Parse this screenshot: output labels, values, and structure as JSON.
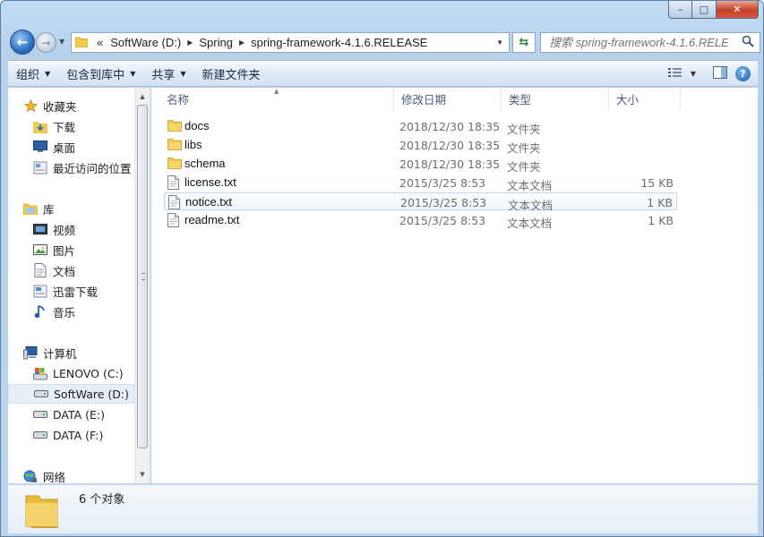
{
  "window": {
    "caption": {
      "minimize": "–",
      "maximize": "□",
      "close": "✕"
    }
  },
  "nav": {
    "back_glyph": "←",
    "forward_glyph": "→",
    "breadcrumb": [
      "SoftWare (D:)",
      "Spring",
      "spring-framework-4.1.6.RELEASE"
    ],
    "overflow_marker": "«",
    "search_placeholder": "搜索 spring-framework-4.1.6.RELE..."
  },
  "commandbar": {
    "items": [
      {
        "label": "组织",
        "has_dropdown": true
      },
      {
        "label": "包含到库中",
        "has_dropdown": true
      },
      {
        "label": "共享",
        "has_dropdown": true
      },
      {
        "label": "新建文件夹",
        "has_dropdown": false
      }
    ],
    "help_label": "?"
  },
  "sidebar": {
    "items": [
      {
        "label": "收藏夹",
        "icon": "star-icon",
        "level": 0
      },
      {
        "label": "下载",
        "icon": "downloads-folder-icon",
        "level": 1
      },
      {
        "label": "桌面",
        "icon": "desktop-icon",
        "level": 1
      },
      {
        "label": "最近访问的位置",
        "icon": "recent-places-icon",
        "level": 1
      },
      {
        "label": "库",
        "icon": "library-icon",
        "level": 0
      },
      {
        "label": "视频",
        "icon": "videos-icon",
        "level": 1
      },
      {
        "label": "图片",
        "icon": "pictures-icon",
        "level": 1
      },
      {
        "label": "文档",
        "icon": "documents-icon",
        "level": 1
      },
      {
        "label": "迅雷下载",
        "icon": "thunder-download-icon",
        "level": 1
      },
      {
        "label": "音乐",
        "icon": "music-icon",
        "level": 1
      },
      {
        "label": "计算机",
        "icon": "computer-icon",
        "level": 0
      },
      {
        "label": "LENOVO (C:)",
        "icon": "system-drive-icon",
        "level": 1
      },
      {
        "label": "SoftWare (D:)",
        "icon": "drive-icon",
        "level": 1,
        "selected": true
      },
      {
        "label": "DATA (E:)",
        "icon": "drive-icon",
        "level": 1
      },
      {
        "label": "DATA (F:)",
        "icon": "drive-icon",
        "level": 1
      },
      {
        "label": "网络",
        "icon": "network-icon",
        "level": 0
      }
    ]
  },
  "files": {
    "columns": {
      "name": "名称",
      "modified": "修改日期",
      "type": "类型",
      "size": "大小"
    },
    "rows": [
      {
        "name": "docs",
        "modified": "2018/12/30 18:35",
        "type": "文件夹",
        "size": "",
        "icon": "folder-icon"
      },
      {
        "name": "libs",
        "modified": "2018/12/30 18:35",
        "type": "文件夹",
        "size": "",
        "icon": "folder-icon"
      },
      {
        "name": "schema",
        "modified": "2018/12/30 18:35",
        "type": "文件夹",
        "size": "",
        "icon": "folder-icon"
      },
      {
        "name": "license.txt",
        "modified": "2015/3/25 8:53",
        "type": "文本文档",
        "size": "15 KB",
        "icon": "text-file-icon"
      },
      {
        "name": "notice.txt",
        "modified": "2015/3/25 8:53",
        "type": "文本文档",
        "size": "1 KB",
        "icon": "text-file-icon",
        "selected": true
      },
      {
        "name": "readme.txt",
        "modified": "2015/3/25 8:53",
        "type": "文本文档",
        "size": "1 KB",
        "icon": "text-file-icon"
      }
    ]
  },
  "details": {
    "count": "6 个对象"
  },
  "colors": {
    "accent": "#3c7fd1",
    "folder": "#f2c94c",
    "selection": "#e7eef7"
  }
}
